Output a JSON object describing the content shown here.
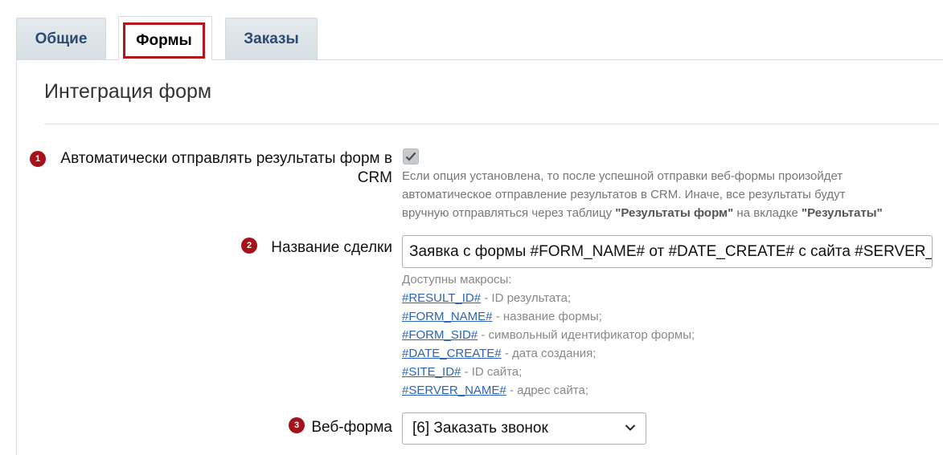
{
  "tabs": {
    "general": "Общие",
    "forms": "Формы",
    "orders": "Заказы"
  },
  "section_title": "Интеграция форм",
  "field1": {
    "badge": "1",
    "label_line1": "Автоматически отправлять результаты форм в",
    "label_line2": "CRM",
    "checked": true,
    "hint_line1": "Если опция установлена, то после успешной отправки веб-формы произойдет",
    "hint_line2": "автоматическое отправление результатов в CRM. Иначе, все результаты будут",
    "hint_line3_a": "вручную отправляться через таблицу ",
    "hint_line3_b": "\"Результаты форм\"",
    "hint_line3_c": " на вкладке ",
    "hint_line3_d": "\"Результаты\""
  },
  "field2": {
    "badge": "2",
    "label": "Название сделки",
    "value": "Заявка с формы #FORM_NAME# от #DATE_CREATE# с сайта #SERVER_NAME#",
    "macros_title": "Доступны макросы:",
    "macros": [
      {
        "code": "#RESULT_ID#",
        "desc": " - ID результата;"
      },
      {
        "code": "#FORM_NAME#",
        "desc": " - название формы;"
      },
      {
        "code": "#FORM_SID#",
        "desc": " - символьный идентификатор формы;"
      },
      {
        "code": "#DATE_CREATE#",
        "desc": " - дата создания;"
      },
      {
        "code": "#SITE_ID#",
        "desc": " - ID сайта;"
      },
      {
        "code": "#SERVER_NAME#",
        "desc": " - адрес сайта;"
      }
    ]
  },
  "field3": {
    "badge": "3",
    "label": "Веб-форма",
    "selected": "[6] Заказать звонок"
  },
  "colors": {
    "tab_text": "#2b4a73",
    "highlight_border": "#b3141b",
    "badge": "#a5121a",
    "link": "#2a65b8"
  }
}
